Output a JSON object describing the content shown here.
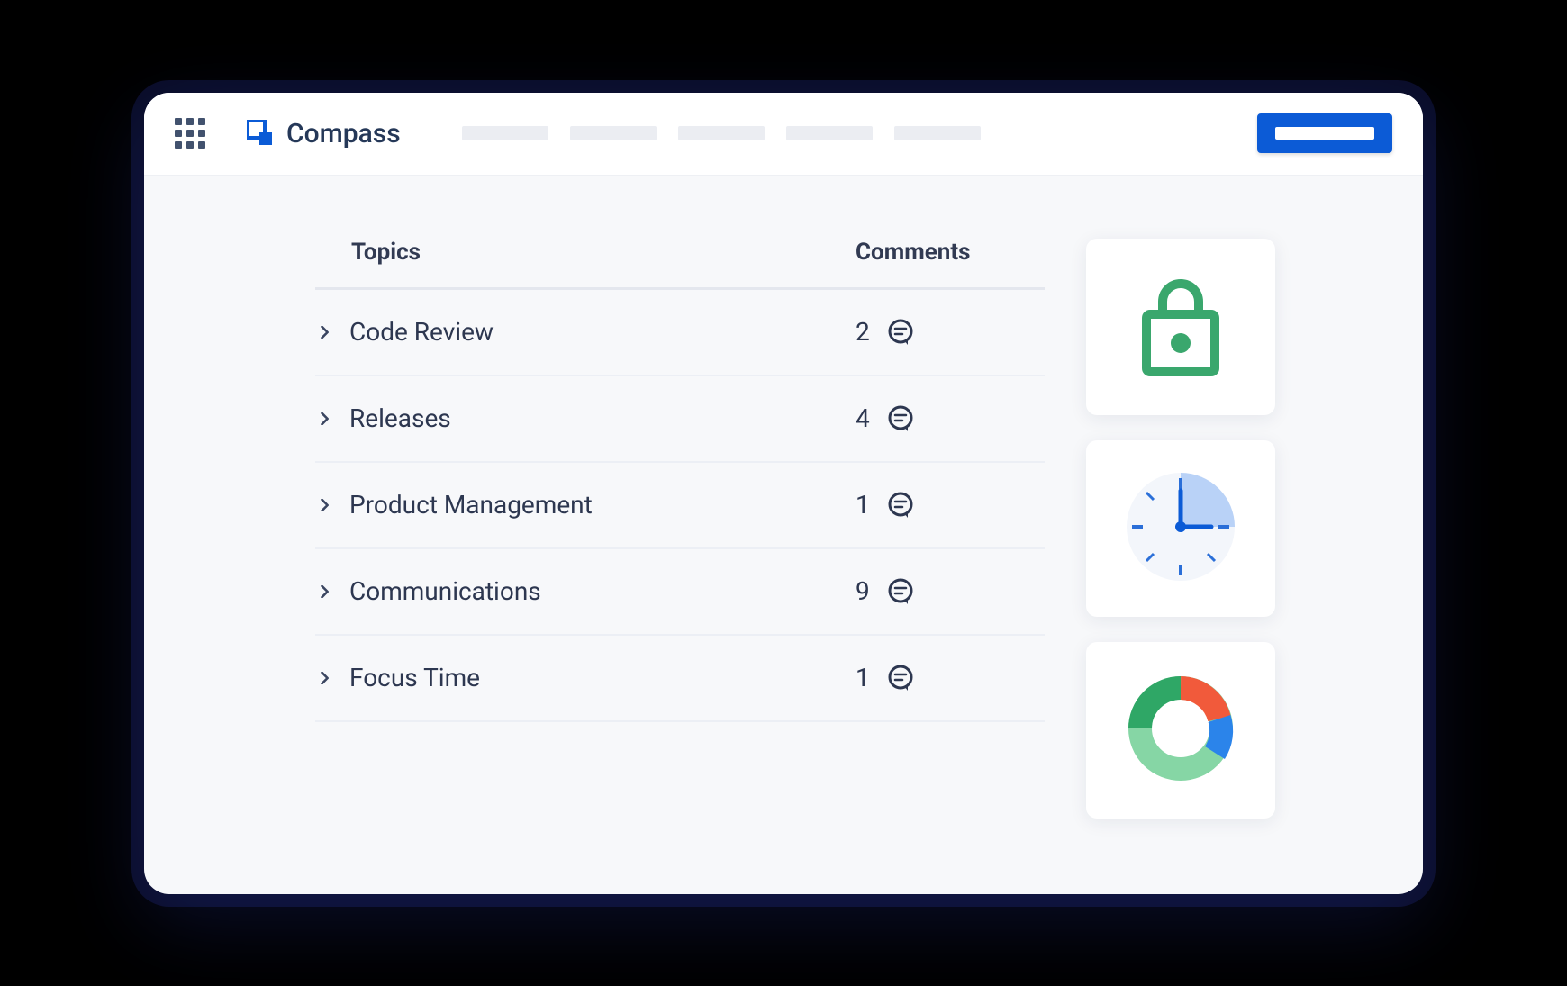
{
  "header": {
    "brand_name": "Compass"
  },
  "table": {
    "columns": {
      "topics": "Topics",
      "comments": "Comments"
    },
    "rows": [
      {
        "topic": "Code Review",
        "count": "2"
      },
      {
        "topic": "Releases",
        "count": "4"
      },
      {
        "topic": "Product Management",
        "count": "1"
      },
      {
        "topic": "Communications",
        "count": "9"
      },
      {
        "topic": "Focus Time",
        "count": "1"
      }
    ]
  },
  "icons": {
    "apps": "apps-grid-icon",
    "brand": "compass-logo-icon",
    "chevron": "chevron-right-icon",
    "comment": "comment-icon",
    "lock": "lock-icon",
    "clock": "clock-icon",
    "donut": "donut-chart-icon"
  }
}
